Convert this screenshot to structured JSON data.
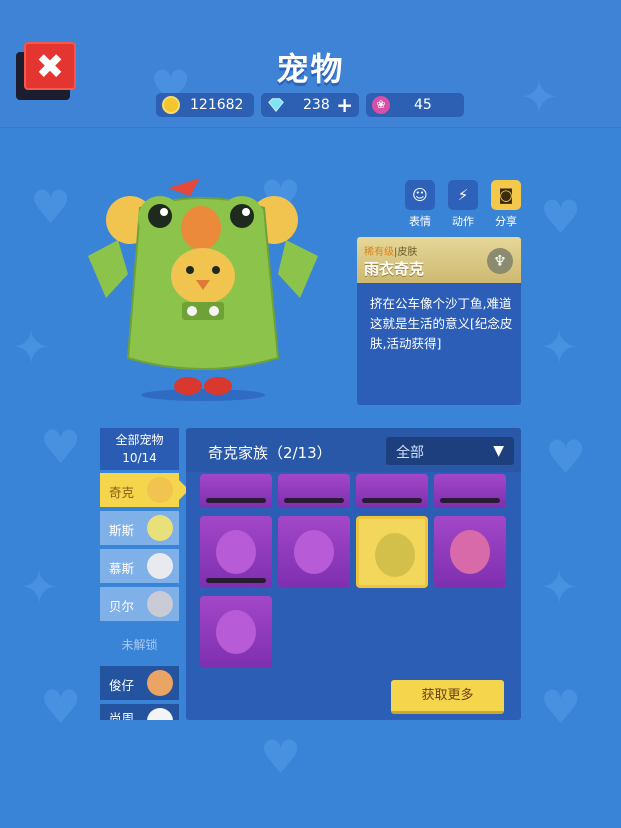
{
  "header": {
    "title": "宠物"
  },
  "currency": {
    "coins": "121682",
    "gems": "238",
    "gems_add": "+",
    "lotus": "45"
  },
  "actions": [
    {
      "label": "表情"
    },
    {
      "label": "动作"
    },
    {
      "label": "分享"
    }
  ],
  "skin": {
    "rarity": "稀有级",
    "type": "皮肤",
    "name": "雨衣奇克",
    "description": "挤在公车像个沙丁鱼,难道这就是生活的意义[纪念皮肤,活动获得]"
  },
  "sidebar": {
    "all_pets_label": "全部宠物",
    "all_pets_count": "10/14",
    "pets": [
      {
        "label": "奇克"
      },
      {
        "label": "斯斯"
      },
      {
        "label": "慕斯"
      },
      {
        "label": "贝尔"
      }
    ],
    "locked_label": "未解锁",
    "locked_pets": [
      {
        "label": "俊仔"
      },
      {
        "label": "尚周"
      }
    ]
  },
  "panel": {
    "family": "奇克家族（2/13）",
    "filter": "全部",
    "get_more": "获取更多"
  },
  "colors": {
    "background": "#3a84d8",
    "accent": "#f4d54c",
    "close": "#e43530",
    "skin_purple": "#a347c8"
  }
}
